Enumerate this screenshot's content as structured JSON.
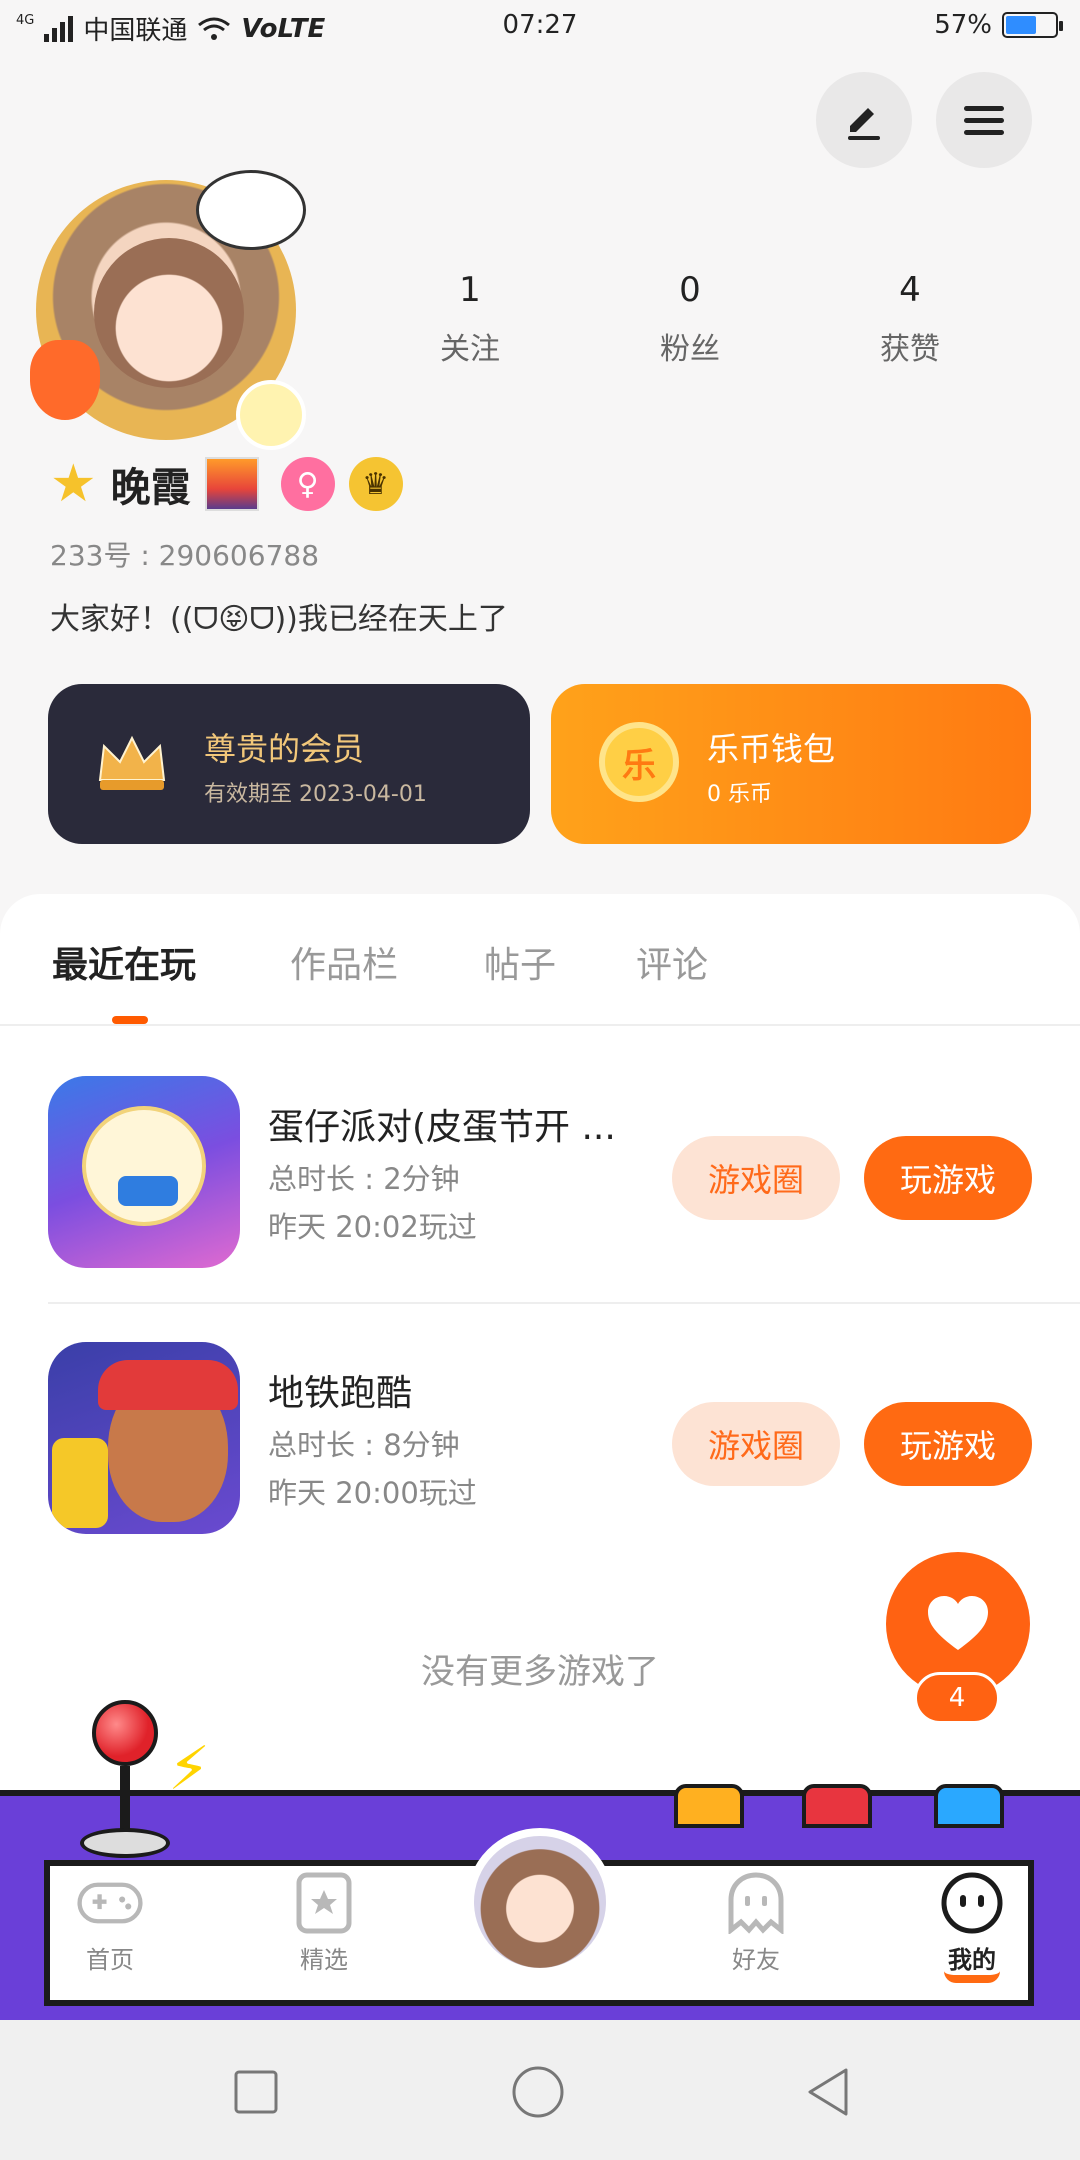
{
  "status_bar": {
    "network_type": "4G",
    "carrier": "中国联通",
    "volte": "VoLTE",
    "time": "07:27",
    "battery_percent": "57%",
    "battery_level": 0.57
  },
  "header": {
    "edit_icon": "pen-icon",
    "menu_icon": "hamburger-icon"
  },
  "profile": {
    "stats": [
      {
        "value": "1",
        "label": "关注"
      },
      {
        "value": "0",
        "label": "粉丝"
      },
      {
        "value": "4",
        "label": "获赞"
      }
    ],
    "name": "晚霞",
    "uid": "233号 : 290606788",
    "bio": "大家好！((ᗜ😝ᗜ))我已经在天上了"
  },
  "cards": {
    "vip": {
      "title": "尊贵的会员",
      "subtitle": "有效期至 2023-04-01"
    },
    "wallet": {
      "title": "乐币钱包",
      "subtitle": "0 乐币",
      "coin_glyph": "乐"
    }
  },
  "tabs": [
    "最近在玩",
    "作品栏",
    "帖子",
    "评论"
  ],
  "games": [
    {
      "name": "蛋仔派对(皮蛋节开 ...",
      "duration": "总时长 : 2分钟",
      "last_played": "昨天 20:02玩过",
      "circle_label": "游戏圈",
      "play_label": "玩游戏"
    },
    {
      "name": "地铁跑酷",
      "duration": "总时长 : 8分钟",
      "last_played": "昨天 20:00玩过",
      "circle_label": "游戏圈",
      "play_label": "玩游戏"
    }
  ],
  "empty_text": "没有更多游戏了",
  "fab": {
    "count": "4"
  },
  "bottom_nav": [
    {
      "label": "首页",
      "icon": "gamepad-icon"
    },
    {
      "label": "精选",
      "icon": "star-card-icon"
    },
    {
      "label": "好友",
      "icon": "ghost-icon"
    },
    {
      "label": "我的",
      "icon": "smile-icon"
    }
  ],
  "colors": {
    "accent": "#ff6a12",
    "vip_bg": "#2a2a3a",
    "arcade_purple": "#6a3fd8"
  }
}
